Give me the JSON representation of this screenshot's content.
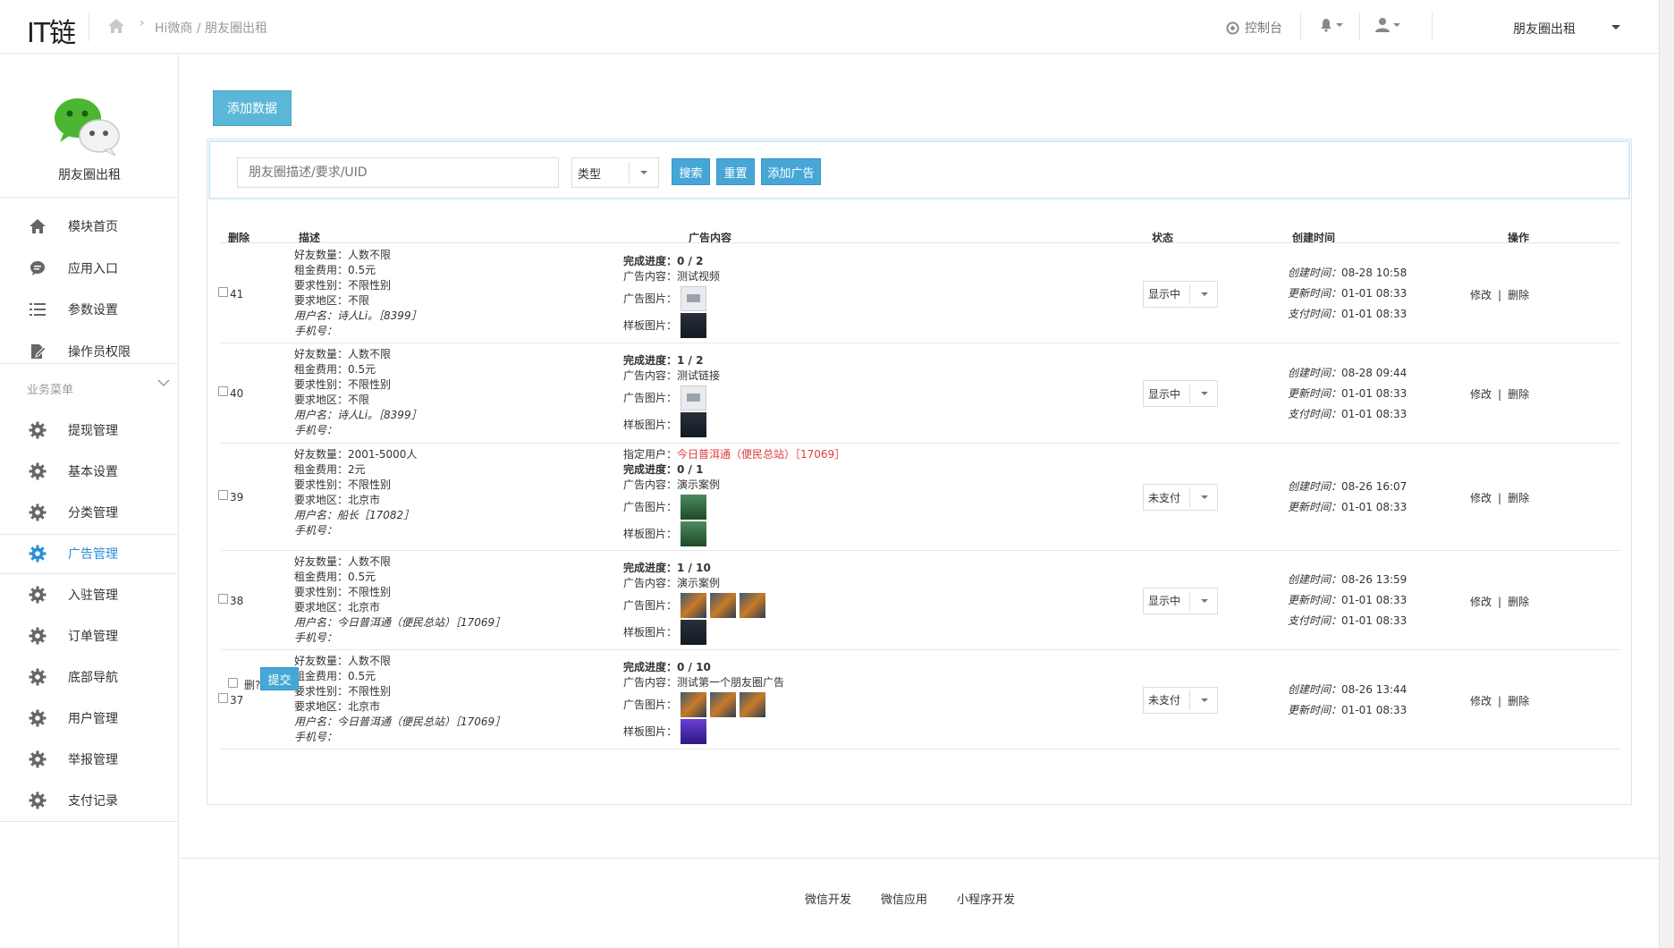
{
  "header": {
    "logo": "IT链",
    "breadcrumb": "Hi微商 / 朋友圈出租",
    "console_label": "控制台",
    "module_label": "朋友圈出租"
  },
  "sidebar": {
    "app_name": "朋友圈出租",
    "top_items": [
      {
        "label": "模块首页",
        "icon": "home-icon"
      },
      {
        "label": "应用入口",
        "icon": "chat-icon"
      },
      {
        "label": "参数设置",
        "icon": "list-icon"
      },
      {
        "label": "操作员权限",
        "icon": "edit-icon"
      }
    ],
    "group_label": "业务菜单",
    "menu_items": [
      {
        "label": "提现管理",
        "icon": "gear-icon"
      },
      {
        "label": "基本设置",
        "icon": "gear-icon"
      },
      {
        "label": "分类管理",
        "icon": "gear-icon"
      },
      {
        "label": "广告管理",
        "icon": "gear-icon",
        "active": true
      },
      {
        "label": "入驻管理",
        "icon": "gear-icon"
      },
      {
        "label": "订单管理",
        "icon": "gear-icon"
      },
      {
        "label": "底部导航",
        "icon": "gear-icon"
      },
      {
        "label": "用户管理",
        "icon": "gear-icon"
      },
      {
        "label": "举报管理",
        "icon": "gear-icon"
      },
      {
        "label": "支付记录",
        "icon": "gear-icon"
      }
    ],
    "active_color": "#2a8fd8"
  },
  "toolbar": {
    "add_data": "添加数据",
    "search_placeholder": "朋友圈描述/要求/UID",
    "type_select": "类型",
    "search_btn": "搜索",
    "reset_btn": "重置",
    "add_ad_btn": "添加广告"
  },
  "table": {
    "headers": {
      "del": "删除",
      "desc": "描述",
      "ad": "广告内容",
      "status": "状态",
      "created": "创建时间",
      "ops": "操作"
    },
    "labels": {
      "friends": "好友数量：",
      "fee": "租金费用：",
      "gender": "要求性别：",
      "region": "要求地区：",
      "username": "用户名：",
      "phone": "手机号：",
      "progress": "完成进度：",
      "ad_content": "广告内容：",
      "ad_images": "广告图片：",
      "template_images": "样板图片：",
      "assigned_user": "指定用户：",
      "created_at": "创建时间：",
      "updated_at": "更新时间：",
      "paid_at": "支付时间：",
      "edit": "修改",
      "delete": "删除",
      "divider": "|"
    },
    "rows": [
      {
        "id": "41",
        "friends": "人数不限",
        "fee": "0.5元",
        "gender": "不限性别",
        "region": "不限",
        "username": "诗人Li。［8399］",
        "phone": "",
        "assigned": "",
        "progress": "0 / 2",
        "ad_content": "测试视频",
        "ad_images": [
          "placeholder"
        ],
        "template_images": [
          "dark"
        ],
        "status": "显示中",
        "created": "08-28 10:58",
        "updated": "01-01 08:33",
        "paid": "01-01 08:33"
      },
      {
        "id": "40",
        "friends": "人数不限",
        "fee": "0.5元",
        "gender": "不限性别",
        "region": "不限",
        "username": "诗人Li。［8399］",
        "phone": "",
        "assigned": "",
        "progress": "1 / 2",
        "ad_content": "测试链接",
        "ad_images": [
          "placeholder"
        ],
        "template_images": [
          "dark"
        ],
        "status": "显示中",
        "created": "08-28 09:44",
        "updated": "01-01 08:33",
        "paid": "01-01 08:33"
      },
      {
        "id": "39",
        "friends": "2001-5000人",
        "fee": "2元",
        "gender": "不限性别",
        "region": "北京市",
        "username": "船长［17082］",
        "phone": "",
        "assigned": "今日普洱通（便民总站）［17069］",
        "progress": "0 / 1",
        "ad_content": "演示案例",
        "ad_images": [
          "green"
        ],
        "template_images": [
          "green"
        ],
        "status": "未支付",
        "created": "08-26 16:07",
        "updated": "01-01 08:33",
        "paid": ""
      },
      {
        "id": "38",
        "friends": "人数不限",
        "fee": "0.5元",
        "gender": "不限性别",
        "region": "北京市",
        "username": "今日普洱通（便民总站）［17069］",
        "phone": "",
        "assigned": "",
        "progress": "1 / 10",
        "ad_content": "演示案例",
        "ad_images": [
          "photo",
          "photo",
          "photo"
        ],
        "template_images": [
          "dark"
        ],
        "status": "显示中",
        "created": "08-26 13:59",
        "updated": "01-01 08:33",
        "paid": "01-01 08:33"
      },
      {
        "id": "37",
        "friends": "人数不限",
        "fee": "0.5元",
        "gender": "不限性别",
        "region": "北京市",
        "username": "今日普洱通（便民总站）［17069］",
        "phone": "",
        "assigned": "",
        "progress": "0 / 10",
        "ad_content": "测试第一个朋友圈广告",
        "ad_images": [
          "photo",
          "photo",
          "photo"
        ],
        "template_images": [
          "purple"
        ],
        "status": "未支付",
        "created": "08-26 13:44",
        "updated": "01-01 08:33",
        "paid": ""
      }
    ]
  },
  "bottom": {
    "delete_label": "删?",
    "submit": "提交"
  },
  "footer": {
    "links": [
      "微信开发",
      "微信应用",
      "小程序开发"
    ]
  },
  "colors": {
    "primary_button": "#46a7d6",
    "add_data_button": "#5bb7d8",
    "assigned_user_text": "#e03c3c"
  }
}
